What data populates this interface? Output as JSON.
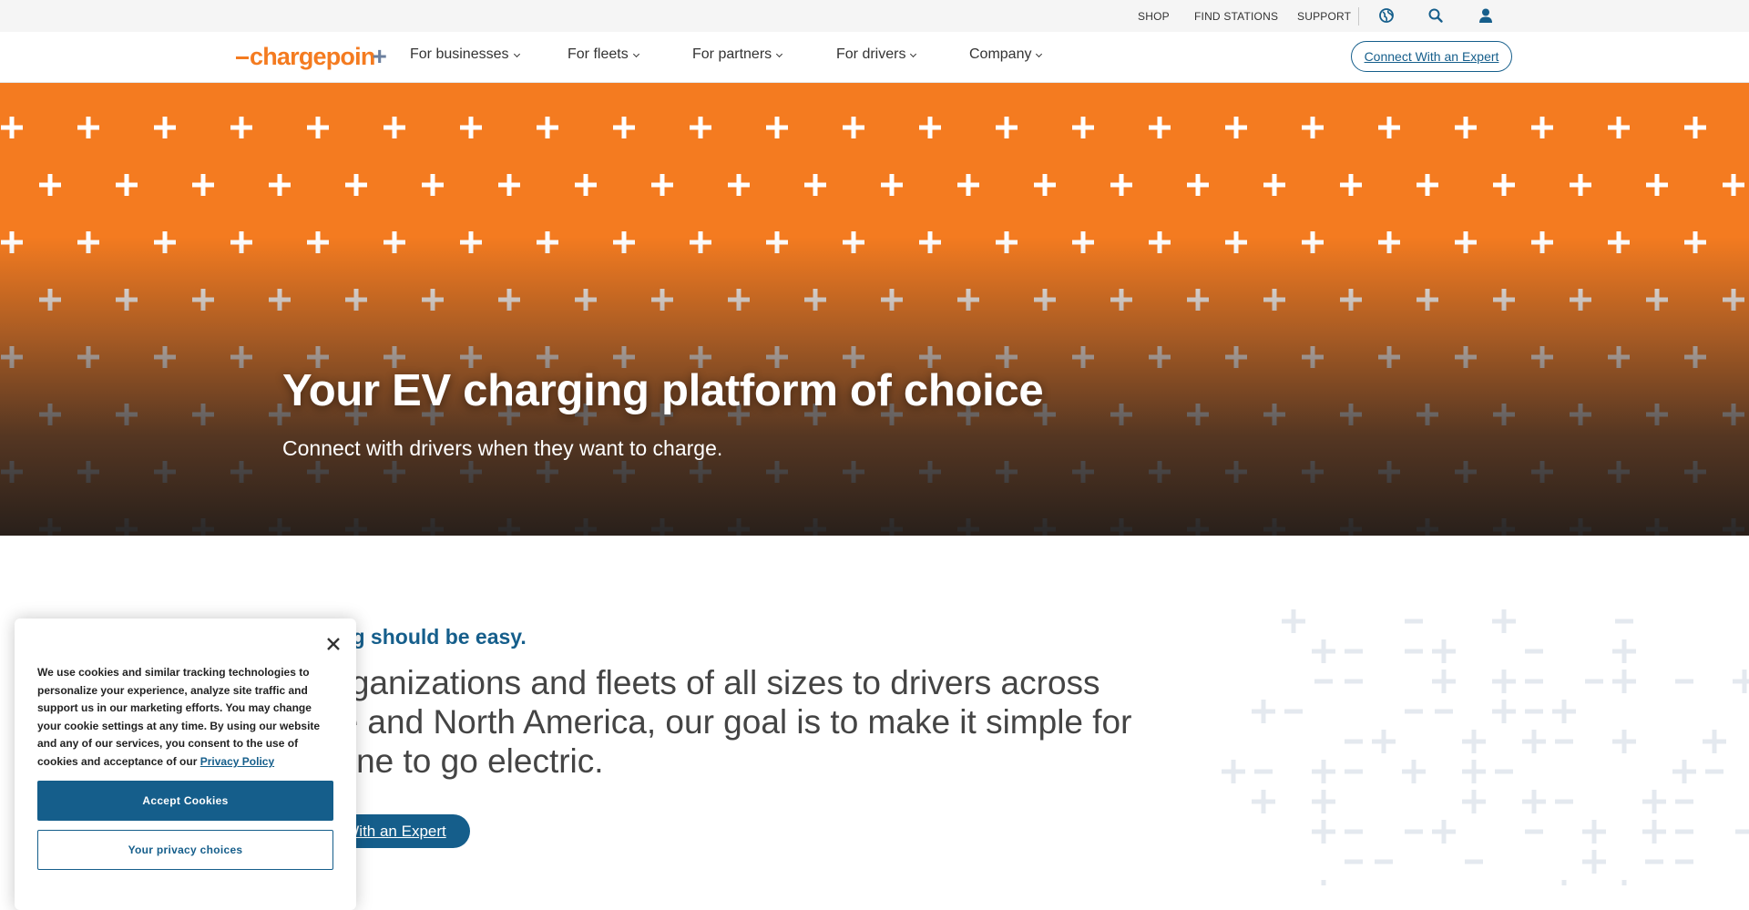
{
  "utility": {
    "links": [
      "SHOP",
      "FIND STATIONS",
      "SUPPORT"
    ],
    "icons": [
      "globe-icon",
      "search-icon",
      "user-icon"
    ]
  },
  "nav": {
    "logo_text": "chargepoin",
    "logo_plus": "+",
    "items": [
      "For businesses",
      "For fleets",
      "For partners",
      "For drivers",
      "Company"
    ],
    "cta": "Connect With an Expert"
  },
  "hero": {
    "title": "Your EV charging platform of choice",
    "subtitle": "Connect with drivers when they want to charge."
  },
  "intro": {
    "tagline": "ging should be easy.",
    "body_lines": [
      " organizations and fleets of all sizes to drivers across",
      "pe and North America, our goal is to make it simple for",
      "yone to go electric."
    ],
    "cta": " With an Expert"
  },
  "cookie": {
    "body": "We use cookies and similar tracking technologies to personalize your experience, analyze site traffic and support us in our marketing efforts. You may change your cookie settings at any time. By using our website and any of our services, you consent to the use of cookies and acceptance of our ",
    "policy_link": "Privacy Policy",
    "accept": "Accept Cookies",
    "choices": "Your privacy choices"
  },
  "colors": {
    "brand_orange": "#f47b20",
    "brand_blue": "#155e8b",
    "deco_gray": "#e4e9ef"
  }
}
